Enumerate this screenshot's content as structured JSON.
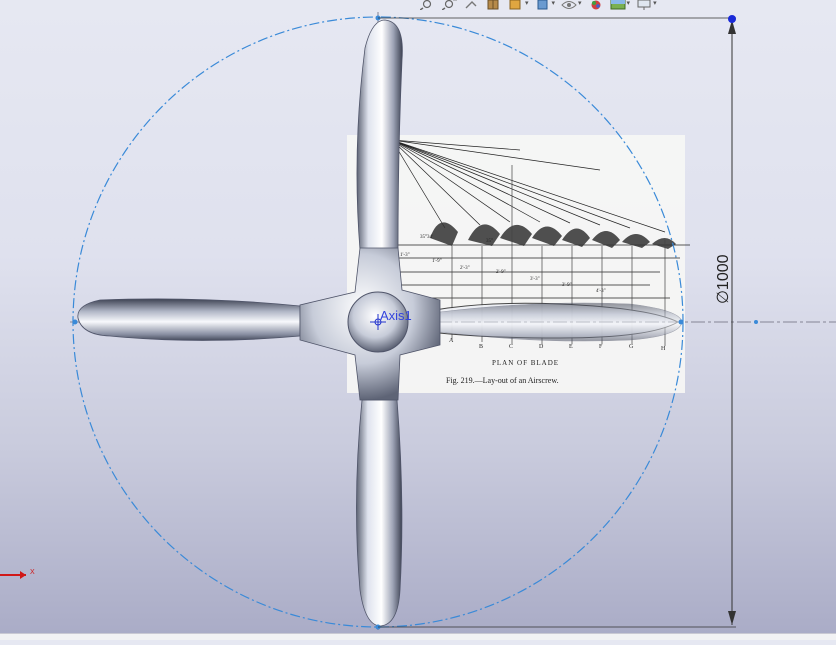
{
  "viewport": {
    "dimension_label": "∅1000",
    "axis_label": "Axis1",
    "triad_axis_x": "X"
  },
  "sketch_image": {
    "caption": "Fig. 219.—Lay-out of an Airscrew.",
    "plan_label": "PLAN OF BLADE",
    "station_labels": [
      "A",
      "B",
      "C",
      "D",
      "E",
      "F",
      "G",
      "H"
    ],
    "angle_labels": [
      "35°34'",
      "35°"
    ],
    "dimension_labels": [
      "1'-3\"",
      "1'-9\"",
      "2'-3\"",
      "2'-9\"",
      "3'-3\"",
      "3'-9\"",
      "4'-3\""
    ]
  },
  "toolbar": {
    "icons": [
      "zoom-to-fit-icon",
      "zoom-to-area-icon",
      "previous-view-icon",
      "section-view-icon",
      "view-orientation-icon",
      "display-style-icon",
      "hide-show-items-icon",
      "edit-appearance-icon",
      "apply-scene-icon",
      "view-settings-icon"
    ]
  }
}
